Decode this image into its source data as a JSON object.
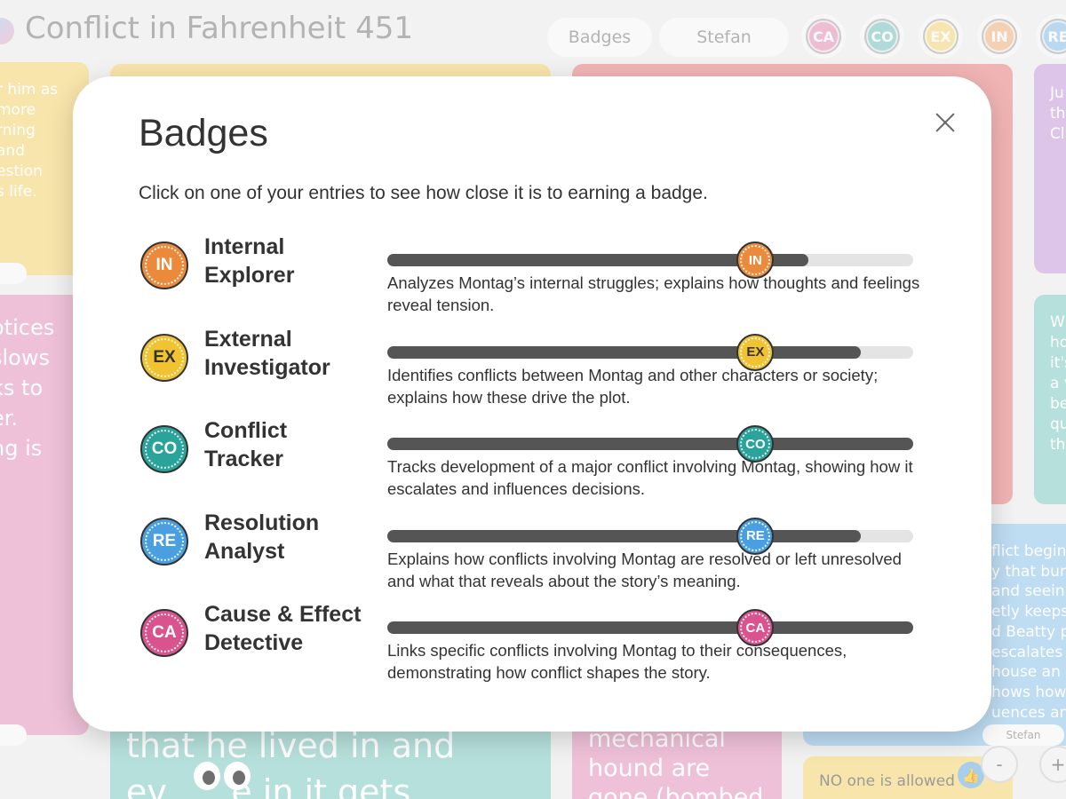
{
  "app": {
    "title": "Conflict in Fahrenheit 451",
    "badges_button": "Badges",
    "user_button": "Stefan",
    "top_badges": [
      {
        "abbr": "CA",
        "color": "#d9548f"
      },
      {
        "abbr": "CO",
        "color": "#2aa39b"
      },
      {
        "abbr": "EX",
        "color": "#f1c232"
      },
      {
        "abbr": "IN",
        "color": "#ec8a3c"
      },
      {
        "abbr": "RE",
        "color": "#4a9fe0"
      }
    ]
  },
  "background_notes": {
    "yellow_left": [
      "r him as",
      "more",
      "rning",
      "and",
      "estion",
      "s life."
    ],
    "pink_left": [
      "otices",
      "slows",
      "ks to",
      "er.",
      "ng is"
    ],
    "purple_right": [
      "Ju",
      "th",
      "Cl"
    ],
    "teal_right": [
      "W",
      "ho",
      "it's",
      "a v",
      "be",
      "qu",
      "th"
    ],
    "blue_right": [
      "flict begins",
      "y that burn",
      "and seein",
      "etly keeps",
      "d Beatty p",
      "escalates",
      "house an",
      "hows how",
      "uences and"
    ],
    "blue_right_author": "Stefan",
    "teal_bottom": "that he lived in and",
    "teal_bottom_2": "ev      e in it gets",
    "pink_bottom": [
      "mechanical",
      "hound are",
      "gone (bombed"
    ],
    "yellow_bottom": "NO one is allowed",
    "minus_label": "-",
    "plus_label": "+"
  },
  "modal": {
    "title": "Badges",
    "subtitle": "Click on one of your entries to see how close it is to earning a badge.",
    "badges": [
      {
        "abbr": "IN",
        "name_line1": "Internal",
        "name_line2": "Explorer",
        "color": "#ec8a3c",
        "knob_text_color": "#ffffff",
        "progress": 0.8,
        "marker": 0.7,
        "description": "Analyzes Montag’s internal struggles; explains how thoughts and feelings reveal tension."
      },
      {
        "abbr": "EX",
        "name_line1": "External",
        "name_line2": "Investigator",
        "color": "#f1c232",
        "knob_text_color": "#333333",
        "progress": 0.9,
        "marker": 0.7,
        "description": "Identifies conflicts between Montag and other characters or society; explains how these drive the plot."
      },
      {
        "abbr": "CO",
        "name_line1": "Conflict",
        "name_line2": "Tracker",
        "color": "#2aa39b",
        "knob_text_color": "#ffffff",
        "progress": 1.0,
        "marker": 0.7,
        "description": "Tracks development of a major conflict involving Montag, showing how it escalates and influences decisions."
      },
      {
        "abbr": "RE",
        "name_line1": "Resolution",
        "name_line2": "Analyst",
        "color": "#4a9fe0",
        "knob_text_color": "#ffffff",
        "progress": 0.9,
        "marker": 0.7,
        "description": "Explains how conflicts involving Montag are resolved or left unresolved and what that reveals about the story’s meaning."
      },
      {
        "abbr": "CA",
        "name_line1": "Cause & Effect",
        "name_line2": "Detective",
        "color": "#d9548f",
        "knob_text_color": "#ffffff",
        "progress": 1.0,
        "marker": 0.7,
        "description": "Links specific conflicts involving Montag to their consequences, demonstrating how conflict shapes the story."
      }
    ]
  }
}
